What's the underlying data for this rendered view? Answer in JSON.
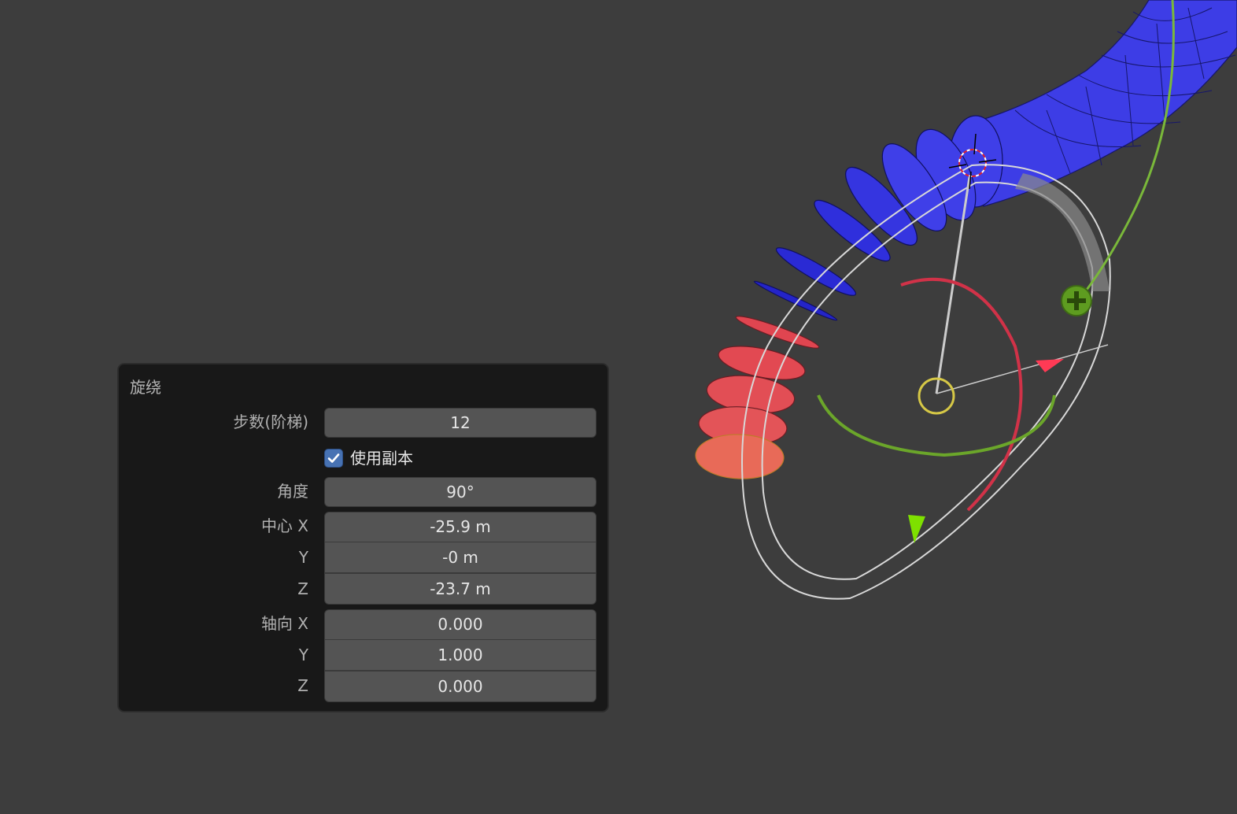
{
  "redo_panel": {
    "title": "旋绕",
    "steps": {
      "label": "步数(阶梯)",
      "value": "12"
    },
    "use_duplicates": {
      "label": "使用副本",
      "checked": true
    },
    "angle": {
      "label": "角度",
      "value": "90°"
    },
    "center": {
      "label_x": "中心 X",
      "label_y": "Y",
      "label_z": "Z",
      "x": "-25.9 m",
      "y": "-0 m",
      "z": "-23.7 m"
    },
    "axis": {
      "label_x": "轴向 X",
      "label_y": "Y",
      "label_z": "Z",
      "x": "0.000",
      "y": "1.000",
      "z": "0.000"
    }
  },
  "colors": {
    "viewport_bg": "#3d3d3d",
    "panel_bg": "#181818",
    "field_bg": "#545454",
    "checkbox_accent": "#4772b3",
    "mesh_blue": "#3b3be0",
    "mesh_red": "#e04a52",
    "gizmo_red": "#d6344a",
    "gizmo_green": "#6aaa2a",
    "gizmo_yellow": "#d7c84a"
  },
  "icons": {
    "checkbox": "checkmark-icon",
    "add_handle": "plus-icon",
    "cursor": "3d-cursor-icon"
  }
}
